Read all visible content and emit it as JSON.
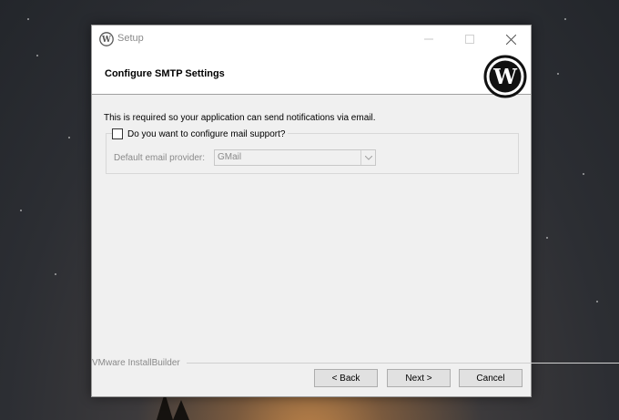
{
  "window": {
    "title": "Setup",
    "controls": {
      "minimize": "minimize-icon",
      "maximize": "maximize-icon",
      "close": "close-icon"
    }
  },
  "header": {
    "title": "Configure SMTP Settings",
    "logo": "wordpress-logo"
  },
  "content": {
    "description": "This is required so your application can send notifications via email.",
    "mail_checkbox": {
      "label": "Do you want to configure mail support?",
      "checked": false
    },
    "provider": {
      "label": "Default email provider:",
      "value": "GMail",
      "enabled": false
    }
  },
  "footer": {
    "brand": "VMware InstallBuilder",
    "buttons": {
      "back": "< Back",
      "next": "Next >",
      "cancel": "Cancel"
    }
  },
  "colors": {
    "dialog_bg": "#f0f0f0",
    "header_bg": "#ffffff",
    "disabled_text": "#8a8a8a"
  }
}
